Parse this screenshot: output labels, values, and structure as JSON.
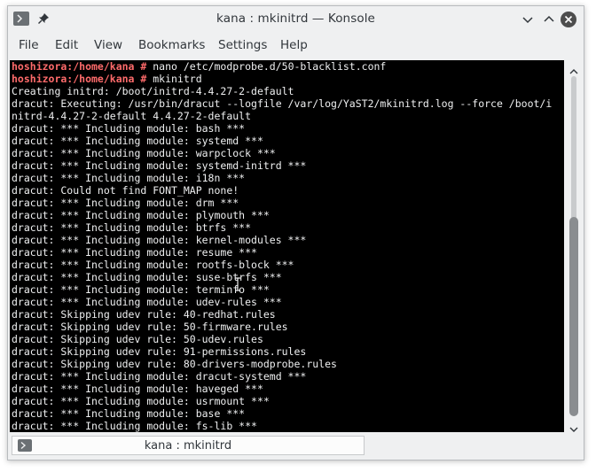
{
  "window": {
    "title": "kana : mkinitrd — Konsole",
    "title_icons": [
      "terminal-icon",
      "pin-icon"
    ],
    "controls": [
      "minimize-icon",
      "maximize-icon",
      "close-icon"
    ]
  },
  "menu": {
    "items": [
      "File",
      "Edit",
      "View",
      "Bookmarks",
      "Settings",
      "Help"
    ]
  },
  "terminal": {
    "prompt_color": "#ff6b6b",
    "text_color": "#eff0f1",
    "background": "#000000",
    "lines": [
      {
        "prompt": "hoshizora:/home/kana #",
        "text": " nano /etc/modprobe.d/50-blacklist.conf"
      },
      {
        "prompt": "hoshizora:/home/kana #",
        "text": " mkinitrd"
      },
      {
        "prompt": "",
        "text": "Creating initrd: /boot/initrd-4.4.27-2-default"
      },
      {
        "prompt": "",
        "text": "dracut: Executing: /usr/bin/dracut --logfile /var/log/YaST2/mkinitrd.log --force /boot/i"
      },
      {
        "prompt": "",
        "text": "nitrd-4.4.27-2-default 4.4.27-2-default"
      },
      {
        "prompt": "",
        "text": "dracut: *** Including module: bash ***"
      },
      {
        "prompt": "",
        "text": "dracut: *** Including module: systemd ***"
      },
      {
        "prompt": "",
        "text": "dracut: *** Including module: warpclock ***"
      },
      {
        "prompt": "",
        "text": "dracut: *** Including module: systemd-initrd ***"
      },
      {
        "prompt": "",
        "text": "dracut: *** Including module: i18n ***"
      },
      {
        "prompt": "",
        "text": "dracut: Could not find FONT_MAP none!"
      },
      {
        "prompt": "",
        "text": "dracut: *** Including module: drm ***"
      },
      {
        "prompt": "",
        "text": "dracut: *** Including module: plymouth ***"
      },
      {
        "prompt": "",
        "text": "dracut: *** Including module: btrfs ***"
      },
      {
        "prompt": "",
        "text": "dracut: *** Including module: kernel-modules ***"
      },
      {
        "prompt": "",
        "text": "dracut: *** Including module: resume ***"
      },
      {
        "prompt": "",
        "text": "dracut: *** Including module: rootfs-block ***"
      },
      {
        "prompt": "",
        "text": "dracut: *** Including module: suse-btrfs ***"
      },
      {
        "prompt": "",
        "text": "dracut: *** Including module: terminfo ***"
      },
      {
        "prompt": "",
        "text": "dracut: *** Including module: udev-rules ***"
      },
      {
        "prompt": "",
        "text": "dracut: Skipping udev rule: 40-redhat.rules"
      },
      {
        "prompt": "",
        "text": "dracut: Skipping udev rule: 50-firmware.rules"
      },
      {
        "prompt": "",
        "text": "dracut: Skipping udev rule: 50-udev.rules"
      },
      {
        "prompt": "",
        "text": "dracut: Skipping udev rule: 91-permissions.rules"
      },
      {
        "prompt": "",
        "text": "dracut: Skipping udev rule: 80-drivers-modprobe.rules"
      },
      {
        "prompt": "",
        "text": "dracut: *** Including module: dracut-systemd ***"
      },
      {
        "prompt": "",
        "text": "dracut: *** Including module: haveged ***"
      },
      {
        "prompt": "",
        "text": "dracut: *** Including module: usrmount ***"
      },
      {
        "prompt": "",
        "text": "dracut: *** Including module: base ***"
      },
      {
        "prompt": "",
        "text": "dracut: *** Including module: fs-lib ***"
      }
    ]
  },
  "scrollbar": {
    "position_fraction": 0.46,
    "visible_fraction": 0.59,
    "icons": [
      "scroll-up-icon",
      "scroll-down-icon"
    ]
  },
  "tabs": [
    {
      "label": "kana : mkinitrd",
      "icon": "terminal-icon",
      "active": true
    }
  ]
}
